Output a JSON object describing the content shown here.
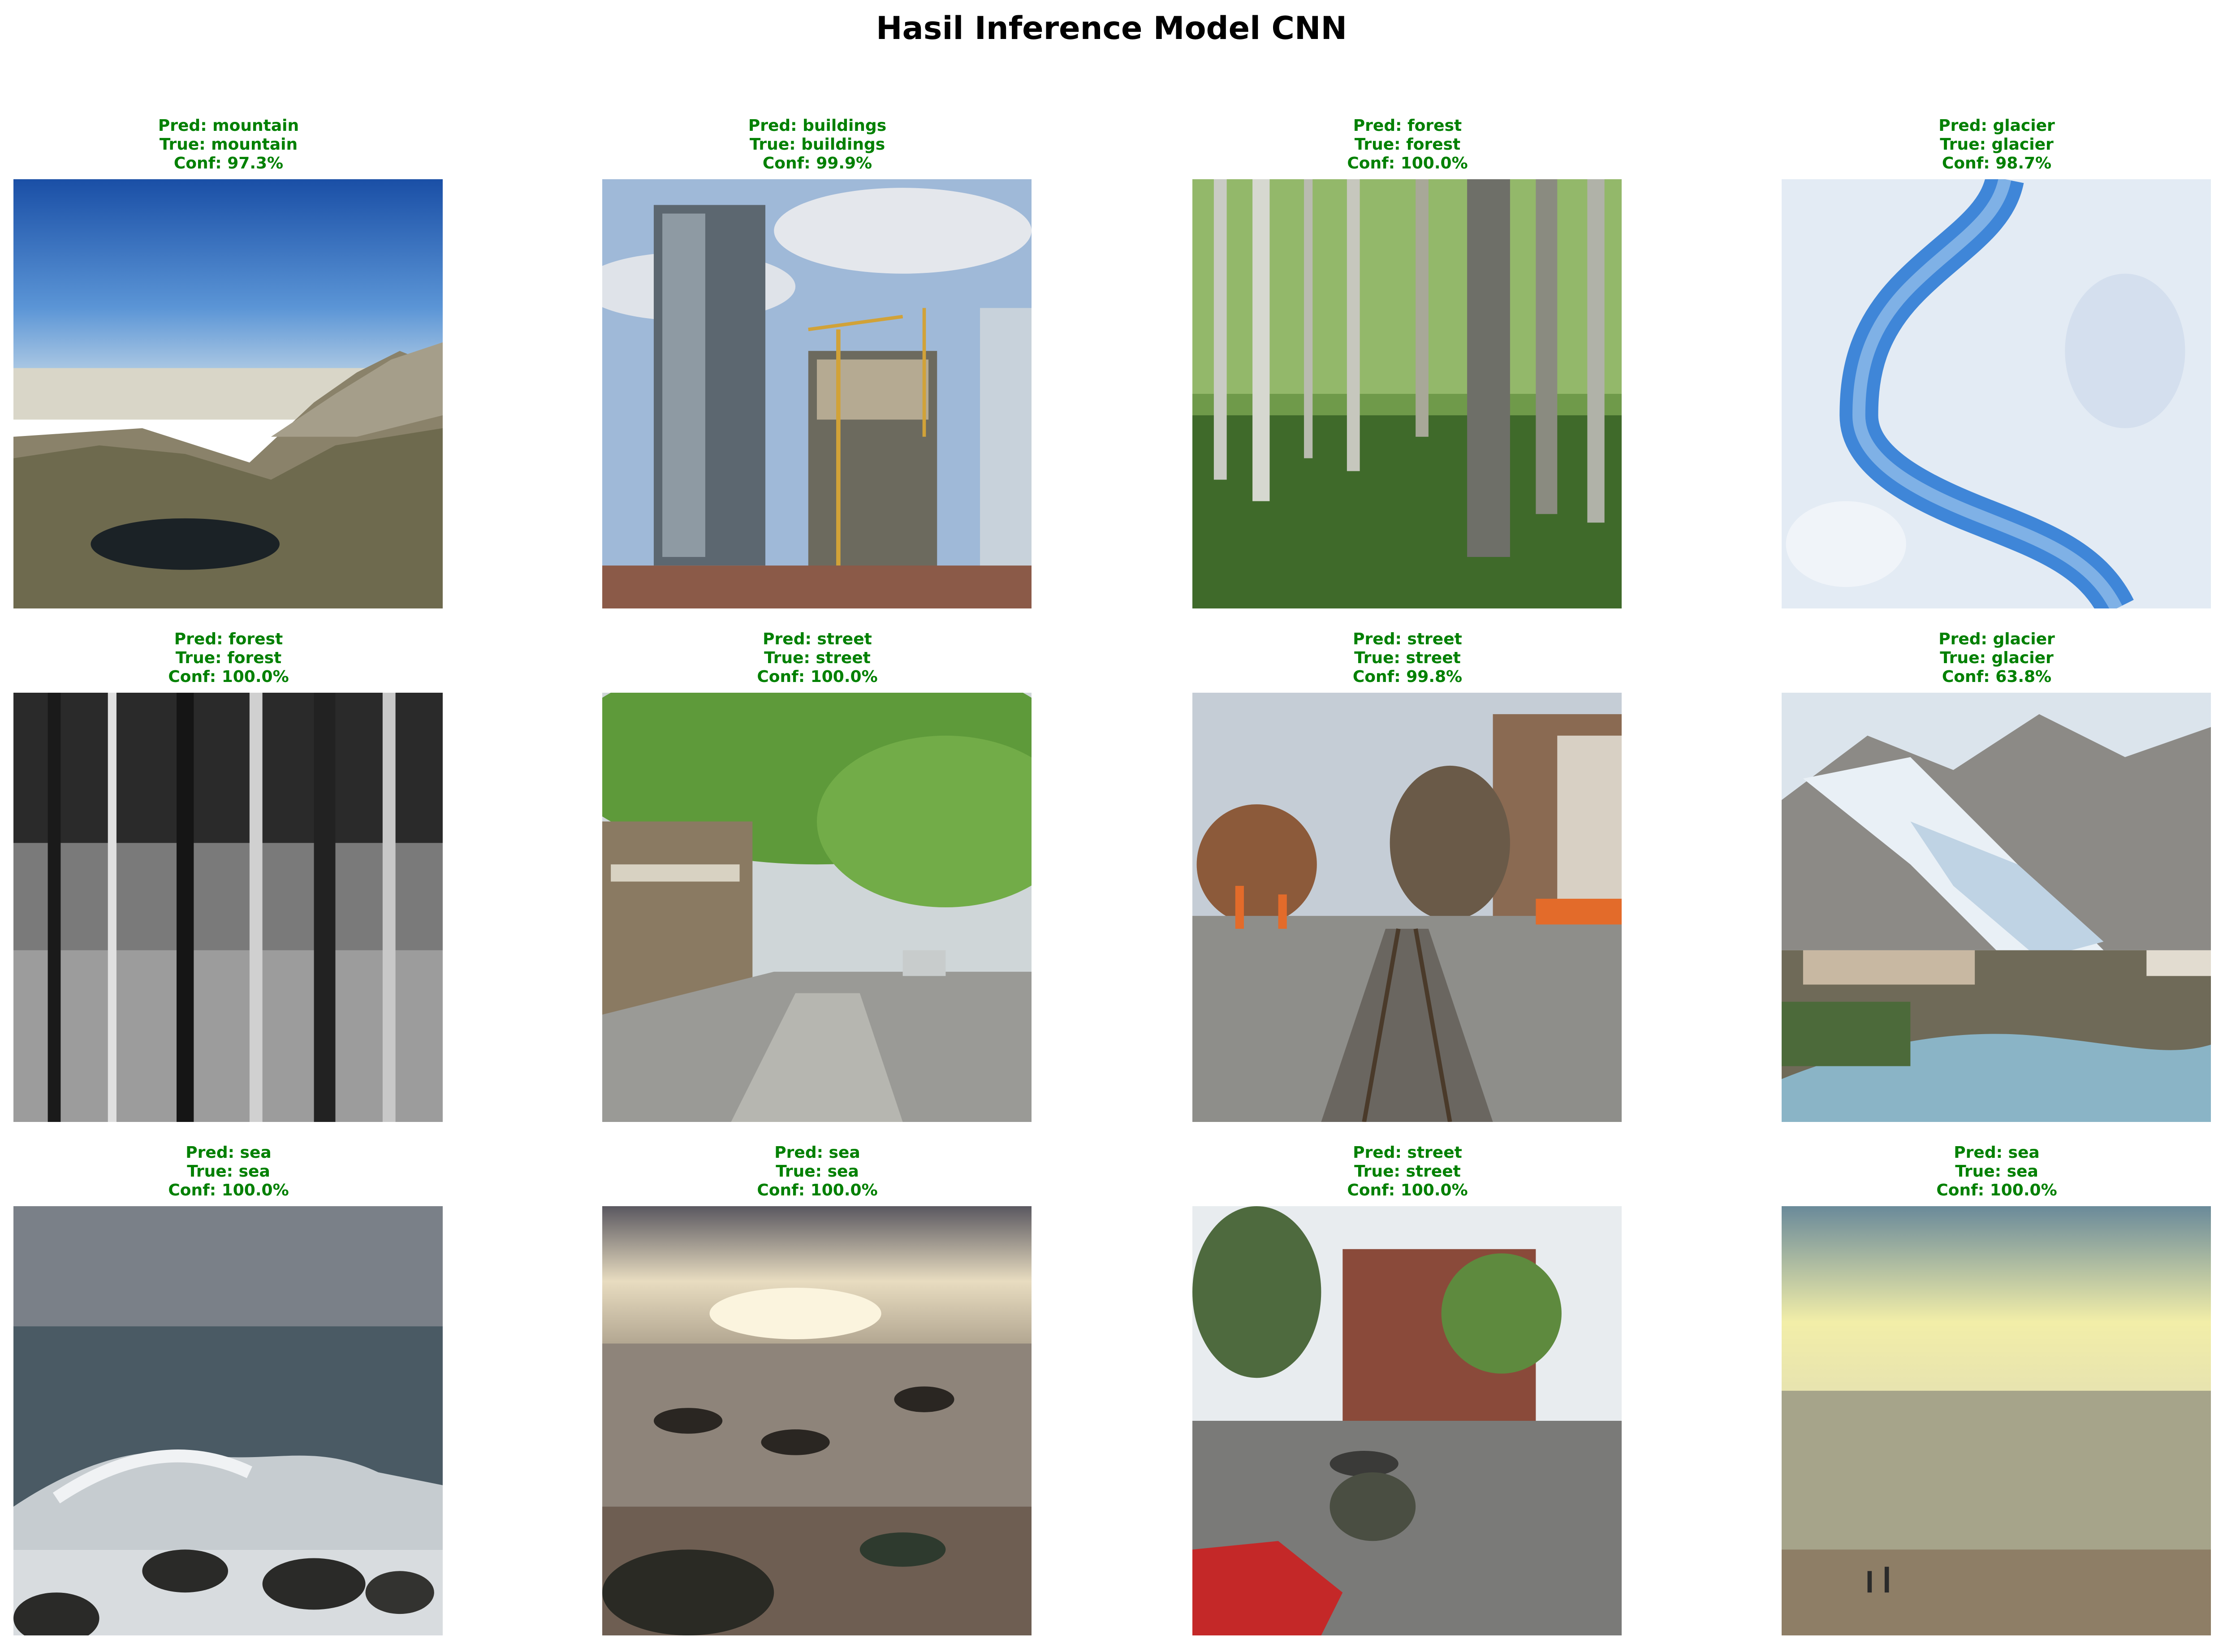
{
  "figure": {
    "title": "Hasil Inference Model CNN",
    "caption_color": "#008000"
  },
  "panels": [
    {
      "pred": "Pred: mountain",
      "true": "True: mountain",
      "conf": "Conf: 97.3%",
      "scene": "mountain"
    },
    {
      "pred": "Pred: buildings",
      "true": "True: buildings",
      "conf": "Conf: 99.9%",
      "scene": "buildings"
    },
    {
      "pred": "Pred: forest",
      "true": "True: forest",
      "conf": "Conf: 100.0%",
      "scene": "forest-color"
    },
    {
      "pred": "Pred: glacier",
      "true": "True: glacier",
      "conf": "Conf: 98.7%",
      "scene": "glacier-aerial"
    },
    {
      "pred": "Pred: forest",
      "true": "True: forest",
      "conf": "Conf: 100.0%",
      "scene": "forest-bw"
    },
    {
      "pred": "Pred: street",
      "true": "True: street",
      "conf": "Conf: 100.0%",
      "scene": "street-trees"
    },
    {
      "pred": "Pred: street",
      "true": "True: street",
      "conf": "Conf: 99.8%",
      "scene": "street-tracks"
    },
    {
      "pred": "Pred: glacier",
      "true": "True: glacier",
      "conf": "Conf: 63.8%",
      "scene": "glacier-valley"
    },
    {
      "pred": "Pred: sea",
      "true": "True: sea",
      "conf": "Conf: 100.0%",
      "scene": "sea-wave"
    },
    {
      "pred": "Pred: sea",
      "true": "True: sea",
      "conf": "Conf: 100.0%",
      "scene": "sea-sunset"
    },
    {
      "pred": "Pred: street",
      "true": "True: street",
      "conf": "Conf: 100.0%",
      "scene": "street-city"
    },
    {
      "pred": "Pred: sea",
      "true": "True: sea",
      "conf": "Conf: 100.0%",
      "scene": "sea-beach"
    }
  ]
}
